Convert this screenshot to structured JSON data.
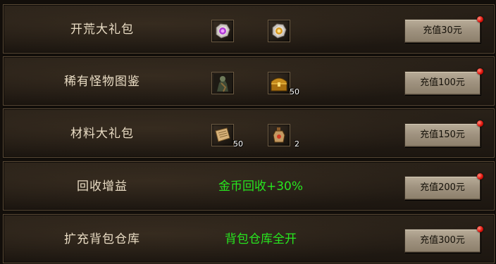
{
  "rows": [
    {
      "title": "开荒大礼包",
      "items": [
        {
          "icon": "purple-gem-stone-icon",
          "qty": ""
        },
        {
          "icon": "gold-gem-stone-icon",
          "qty": ""
        }
      ],
      "button": "充值30元"
    },
    {
      "title": "稀有怪物图鉴",
      "items": [
        {
          "icon": "monster-card-icon",
          "qty": ""
        },
        {
          "icon": "gold-treasure-chest-icon",
          "qty": "50"
        }
      ],
      "button": "充值100元"
    },
    {
      "title": "材料大礼包",
      "items": [
        {
          "icon": "scroll-icon",
          "qty": "50"
        },
        {
          "icon": "potion-bottle-icon",
          "qty": "2"
        }
      ],
      "button": "充值150元"
    },
    {
      "title": "回收增益",
      "reward_text": "金币回收+30%",
      "button": "充值200元"
    },
    {
      "title": "扩充背包仓库",
      "reward_text": "背包仓库全开",
      "button": "充值300元"
    }
  ],
  "colors": {
    "reward_text": "#27e61f",
    "notify_dot": "#e0140c",
    "title_text": "#e9dcc4"
  }
}
